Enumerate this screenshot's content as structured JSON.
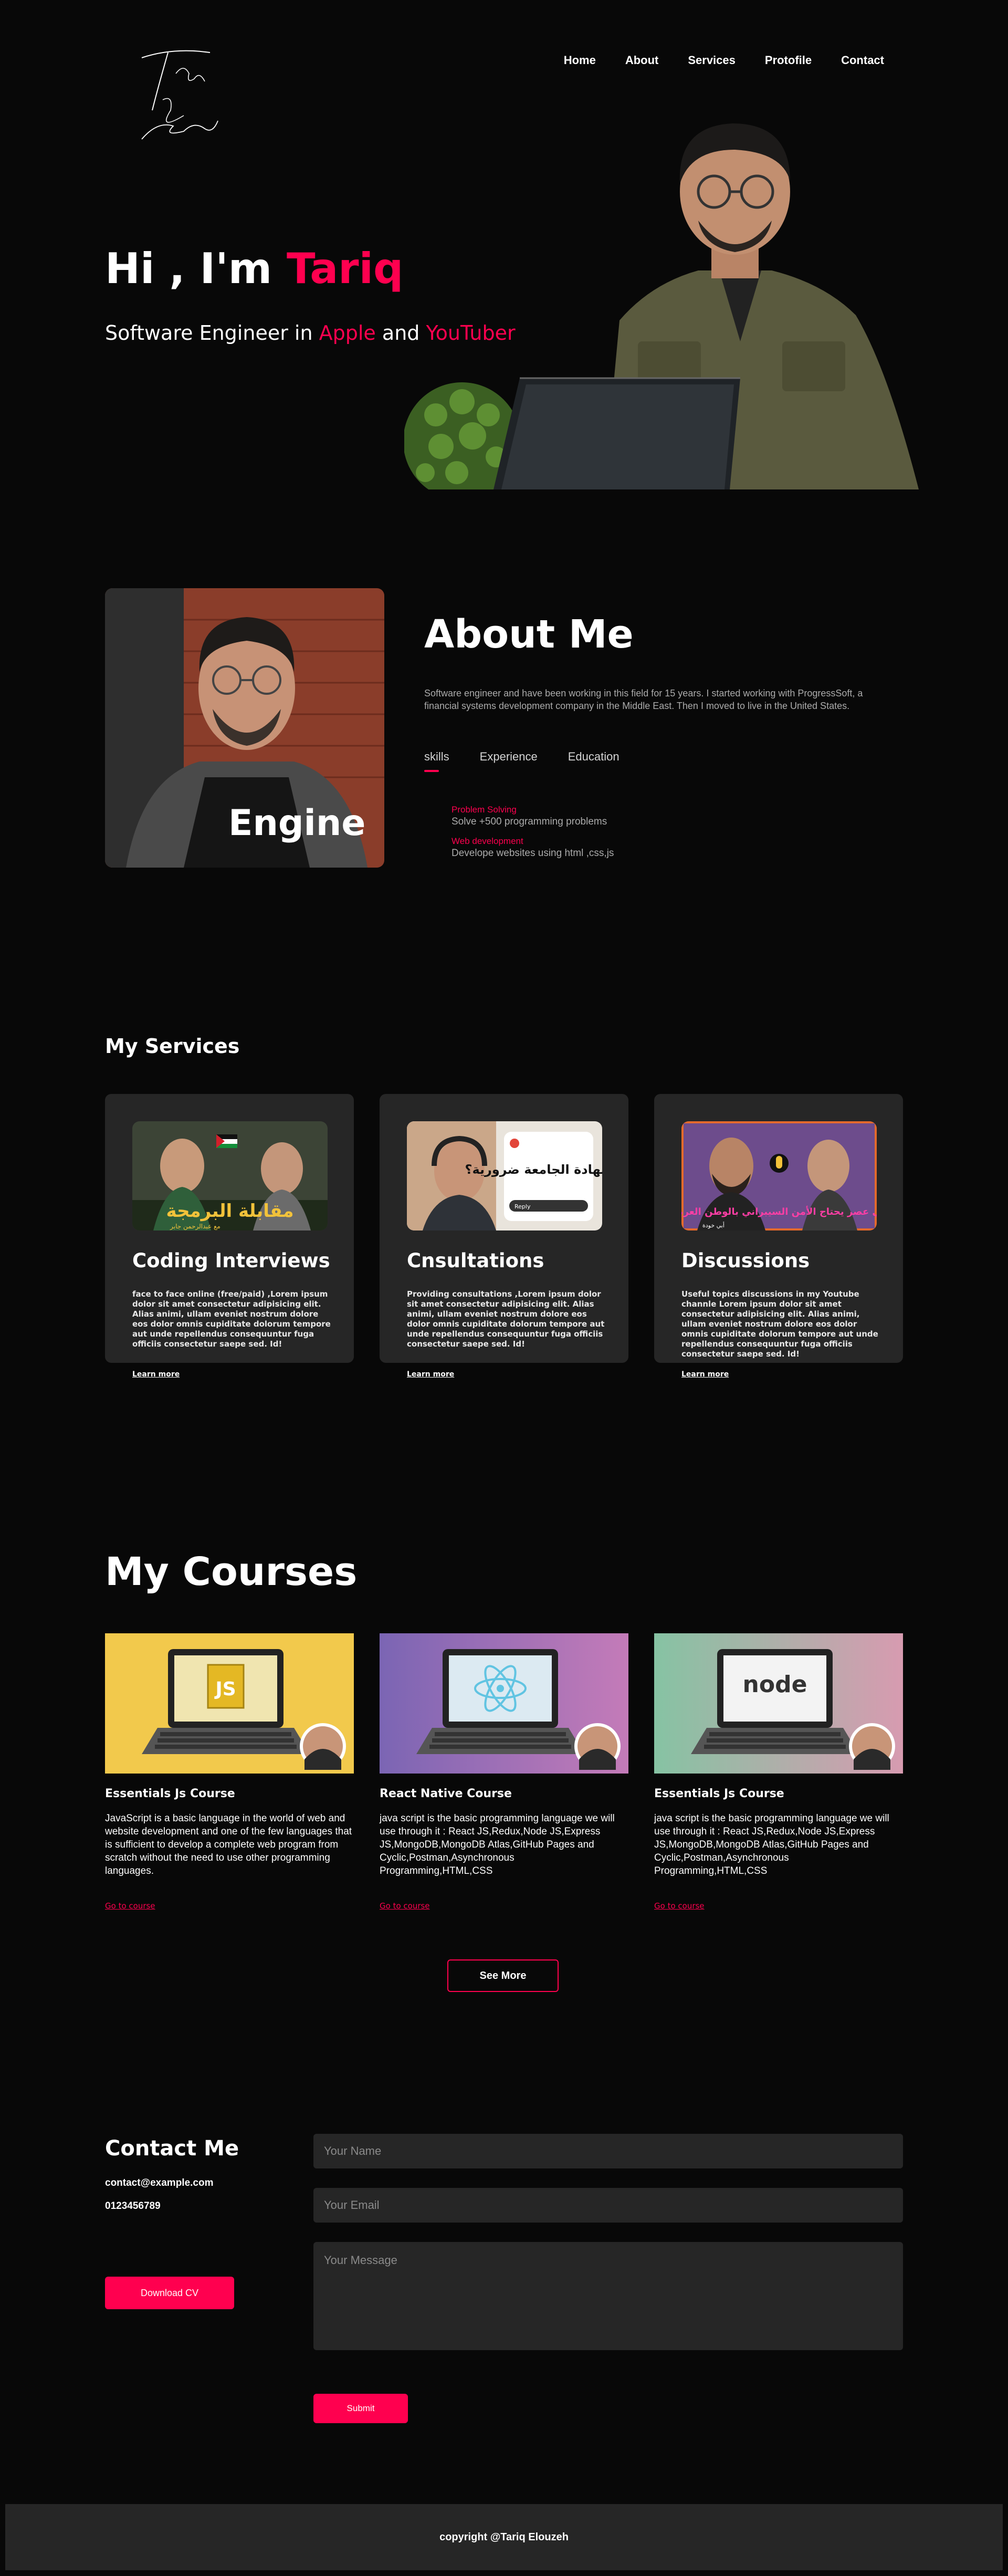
{
  "logo": {
    "line1": "Tariq",
    "line2": "Elouzh"
  },
  "nav": {
    "home": "Home",
    "about": "About",
    "services": "Services",
    "portfolio": "Protofile",
    "contact": "Contact"
  },
  "hero": {
    "greeting": "Hi , I'm ",
    "name": "Tariq",
    "sub_prefix": "Software Engineer in ",
    "sub_company": "Apple",
    "sub_and": " and ",
    "sub_role": "YouTuber"
  },
  "about": {
    "title": "About Me",
    "text": "Software engineer and have been working in this field for 15 years. I started working with ProgressSoft, a financial systems development company in the Middle East. Then I moved to live in the United States.",
    "tabs": [
      "skills",
      "Experience",
      "Education"
    ],
    "skills": [
      {
        "title": "Problem Solving",
        "value": "Solve +500 programming problems"
      },
      {
        "title": "Web development",
        "value": "Develope websites using html ,css,js"
      }
    ],
    "shirt_text": "Engine"
  },
  "services": {
    "title": "My Services",
    "items": [
      {
        "name": "Coding Interviews",
        "desc": "face to face online (free/paid) ,Lorem ipsum dolor sit amet consectetur adipisicing elit. Alias animi, ullam eveniet nostrum dolore eos dolor omnis cupiditate dolorum tempore aut unde repellendus consequuntur fuga officiis consectetur saepe sed. Id!",
        "learn": "Learn more",
        "thumb_text": "مقابلة البرمجة",
        "thumb_sub": "مع عبدالرحمن جابر"
      },
      {
        "name": "Cnsultations",
        "desc": "Providing consultations ,Lorem ipsum dolor sit amet consectetur adipisicing elit. Alias animi, ullam eveniet nostrum dolore eos dolor omnis cupiditate dolorum tempore aut unde repellendus consequuntur fuga officiis consectetur saepe sed. Id!",
        "learn": "Learn more",
        "thumb_text": "هل شهادة الجامعة ضرورية؟",
        "thumb_sub": "Reply"
      },
      {
        "name": "Discussions",
        "desc": "Useful topics discussions in my Youtube channle Lorem ipsum dolor sit amet consectetur adipisicing elit. Alias animi, ullam eveniet nostrum dolore eos dolor omnis cupiditate dolorum tempore aut unde repellendus consequuntur fuga officiis consectetur saepe sed. Id!",
        "learn": "Learn more",
        "thumb_text": "في عصر يحتاج الأمن السيبراني بالوطن العربي",
        "thumb_sub": "أبي خودة"
      }
    ]
  },
  "courses": {
    "title": "My Courses",
    "items": [
      {
        "name": "Essentials Js Course",
        "desc": "JavaScript is a basic language in the world of web and website development and one of the few languages that is sufficient to develop a complete web program from scratch without the need to use other programming languages.",
        "link": "Go to course",
        "badge": "JS",
        "bg": "#f2c94c"
      },
      {
        "name": "React Native Course",
        "desc": "java script is the basic programming language we will use through it : React JS,Redux,Node JS,Express JS,MongoDB,MongoDB Atlas,GitHub Pages and Cyclic,Postman,Asynchronous Programming,HTML,CSS",
        "link": "Go to course",
        "badge": "react",
        "bg": "#9a6fc0"
      },
      {
        "name": "Essentials Js Course",
        "desc": "java script is the basic programming language we will use through it : React JS,Redux,Node JS,Express JS,MongoDB,MongoDB Atlas,GitHub Pages and Cyclic,Postman,Asynchronous Programming,HTML,CSS",
        "link": "Go to course",
        "badge": "node",
        "bg": "#b9a6a6"
      }
    ],
    "see_more": "See More"
  },
  "contact": {
    "title": "Contact Me",
    "email": "contact@example.com",
    "phone": "0123456789",
    "cv": "Download CV",
    "name_placeholder": "Your Name",
    "email_placeholder": "Your Email",
    "message_placeholder": "Your Message",
    "submit": "Submit"
  },
  "footer": {
    "copyright": "copyright @Tariq Elouzeh"
  },
  "colors": {
    "accent": "#ff004f",
    "background": "#080808",
    "card": "#262626",
    "muted": "#ababab"
  }
}
